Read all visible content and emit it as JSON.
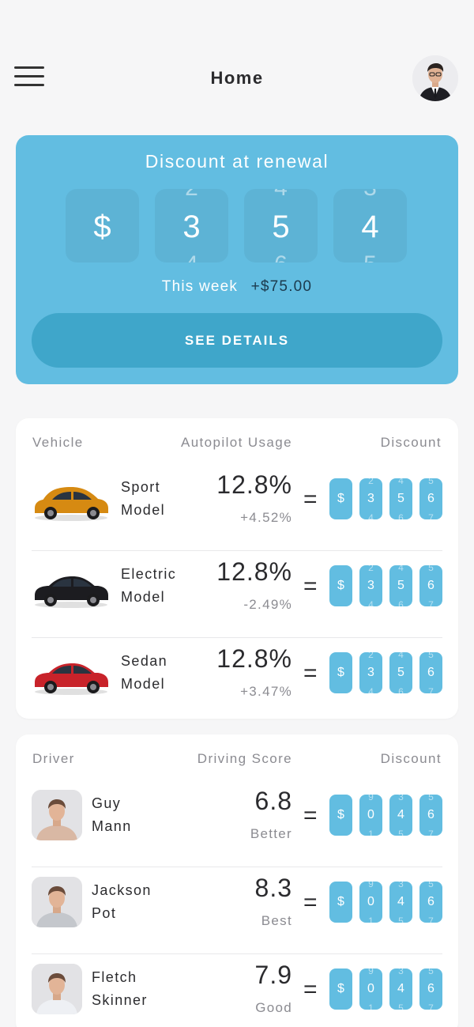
{
  "header": {
    "title": "Home",
    "menu_icon": "hamburger-menu-icon",
    "avatar": "user-avatar"
  },
  "hero": {
    "title": "Discount at renewal",
    "digits": [
      {
        "prev": "",
        "current": "$",
        "next": ""
      },
      {
        "prev": "2",
        "current": "3",
        "next": "4"
      },
      {
        "prev": "4",
        "current": "5",
        "next": "6"
      },
      {
        "prev": "3",
        "current": "4",
        "next": "5"
      }
    ],
    "week_label": "This week",
    "week_value": "+$75.00",
    "button_label": "SEE DETAILS",
    "bg_color": "#62bde1",
    "button_color": "#3fa6ca"
  },
  "vehicles": {
    "headers": {
      "left": "Vehicle",
      "mid": "Autopilot Usage",
      "right": "Discount"
    },
    "rows": [
      {
        "name_line1": "Sport",
        "name_line2": "Model",
        "value": "12.8%",
        "sub": "+4.52%",
        "car_color": "#d68a12",
        "icon": "suv-car-icon",
        "discount": [
          {
            "prev": "",
            "current": "$",
            "next": ""
          },
          {
            "prev": "2",
            "current": "3",
            "next": "4"
          },
          {
            "prev": "4",
            "current": "5",
            "next": "6"
          },
          {
            "prev": "5",
            "current": "6",
            "next": "7"
          }
        ]
      },
      {
        "name_line1": "Electric",
        "name_line2": "Model",
        "value": "12.8%",
        "sub": "-2.49%",
        "car_color": "#1c1c20",
        "icon": "sports-car-icon",
        "discount": [
          {
            "prev": "",
            "current": "$",
            "next": ""
          },
          {
            "prev": "2",
            "current": "3",
            "next": "4"
          },
          {
            "prev": "4",
            "current": "5",
            "next": "6"
          },
          {
            "prev": "5",
            "current": "6",
            "next": "7"
          }
        ]
      },
      {
        "name_line1": "Sedan",
        "name_line2": "Model",
        "value": "12.8%",
        "sub": "+3.47%",
        "car_color": "#c8232a",
        "icon": "coupe-car-icon",
        "discount": [
          {
            "prev": "",
            "current": "$",
            "next": ""
          },
          {
            "prev": "2",
            "current": "3",
            "next": "4"
          },
          {
            "prev": "4",
            "current": "5",
            "next": "6"
          },
          {
            "prev": "5",
            "current": "6",
            "next": "7"
          }
        ]
      }
    ]
  },
  "drivers": {
    "headers": {
      "left": "Driver",
      "mid": "Driving Score",
      "right": "Discount"
    },
    "rows": [
      {
        "name_line1": "Guy",
        "name_line2": "Mann",
        "value": "6.8",
        "sub": "Better",
        "shirt_color": "#d9b8a4",
        "discount": [
          {
            "prev": "",
            "current": "$",
            "next": ""
          },
          {
            "prev": "9",
            "current": "0",
            "next": "1"
          },
          {
            "prev": "3",
            "current": "4",
            "next": "5"
          },
          {
            "prev": "5",
            "current": "6",
            "next": "7"
          }
        ]
      },
      {
        "name_line1": "Jackson",
        "name_line2": "Pot",
        "value": "8.3",
        "sub": "Best",
        "shirt_color": "#c4c7cc",
        "discount": [
          {
            "prev": "",
            "current": "$",
            "next": ""
          },
          {
            "prev": "9",
            "current": "0",
            "next": "1"
          },
          {
            "prev": "3",
            "current": "4",
            "next": "5"
          },
          {
            "prev": "5",
            "current": "6",
            "next": "7"
          }
        ]
      },
      {
        "name_line1": "Fletch",
        "name_line2": "Skinner",
        "value": "7.9",
        "sub": "Good",
        "shirt_color": "#eef0f4",
        "discount": [
          {
            "prev": "",
            "current": "$",
            "next": ""
          },
          {
            "prev": "9",
            "current": "0",
            "next": "1"
          },
          {
            "prev": "3",
            "current": "4",
            "next": "5"
          },
          {
            "prev": "5",
            "current": "6",
            "next": "7"
          }
        ]
      }
    ]
  }
}
